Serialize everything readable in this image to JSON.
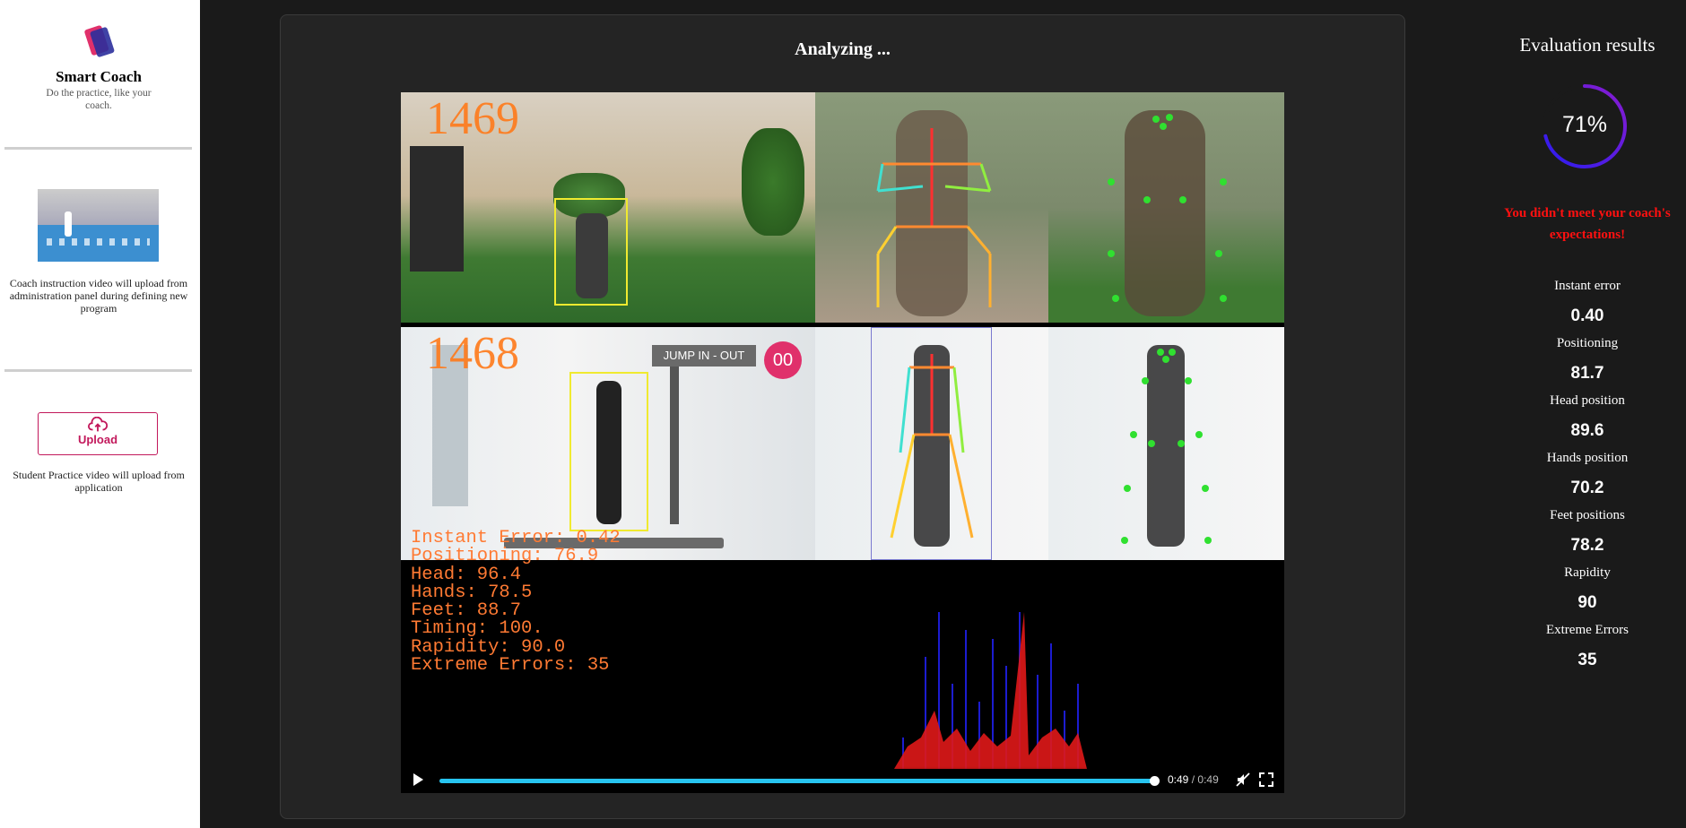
{
  "brand": {
    "name": "Smart Coach",
    "tagline": "Do the practice, like your coach."
  },
  "coach_video": {
    "caption": "Coach instruction video will upload from administration panel during defining new program"
  },
  "upload": {
    "label": "Upload",
    "icon": "cloud-upload-icon",
    "caption": "Student Practice video will upload from application"
  },
  "analysis": {
    "title": "Analyzing ...",
    "frame_top": "1469",
    "frame_bottom": "1468",
    "overlay_badge": "JUMP IN - OUT",
    "overlay_timer": "00",
    "overlay_stats": [
      "Instant Error: 0.42",
      "Positioning: 76.9",
      "Head: 96.4",
      "Hands: 78.5",
      "Feet: 88.7",
      "Timing: 100.",
      "Rapidity: 90.0",
      "Extreme Errors: 35"
    ],
    "player": {
      "current": "0:49",
      "separator": "/",
      "duration": "0:49",
      "progress": 1.0
    }
  },
  "results": {
    "title": "Evaluation results",
    "score_percent": 71,
    "score_label": "71%",
    "message": "You didn't meet your coach's expectations!",
    "message_color": "#ff1010",
    "metrics": [
      {
        "label": "Instant error",
        "value": "0.40"
      },
      {
        "label": "Positioning",
        "value": "81.7"
      },
      {
        "label": "Head position",
        "value": "89.6"
      },
      {
        "label": "Hands position",
        "value": "70.2"
      },
      {
        "label": "Feet positions",
        "value": "78.2"
      },
      {
        "label": "Rapidity",
        "value": "90"
      },
      {
        "label": "Extreme Errors",
        "value": "35"
      }
    ]
  },
  "colors": {
    "accent": "#c2185b",
    "progress": "#27c4f0",
    "overlay_text": "#ff7a33",
    "gauge_start": "#2a1cf0",
    "gauge_end": "#8a1cd0"
  }
}
